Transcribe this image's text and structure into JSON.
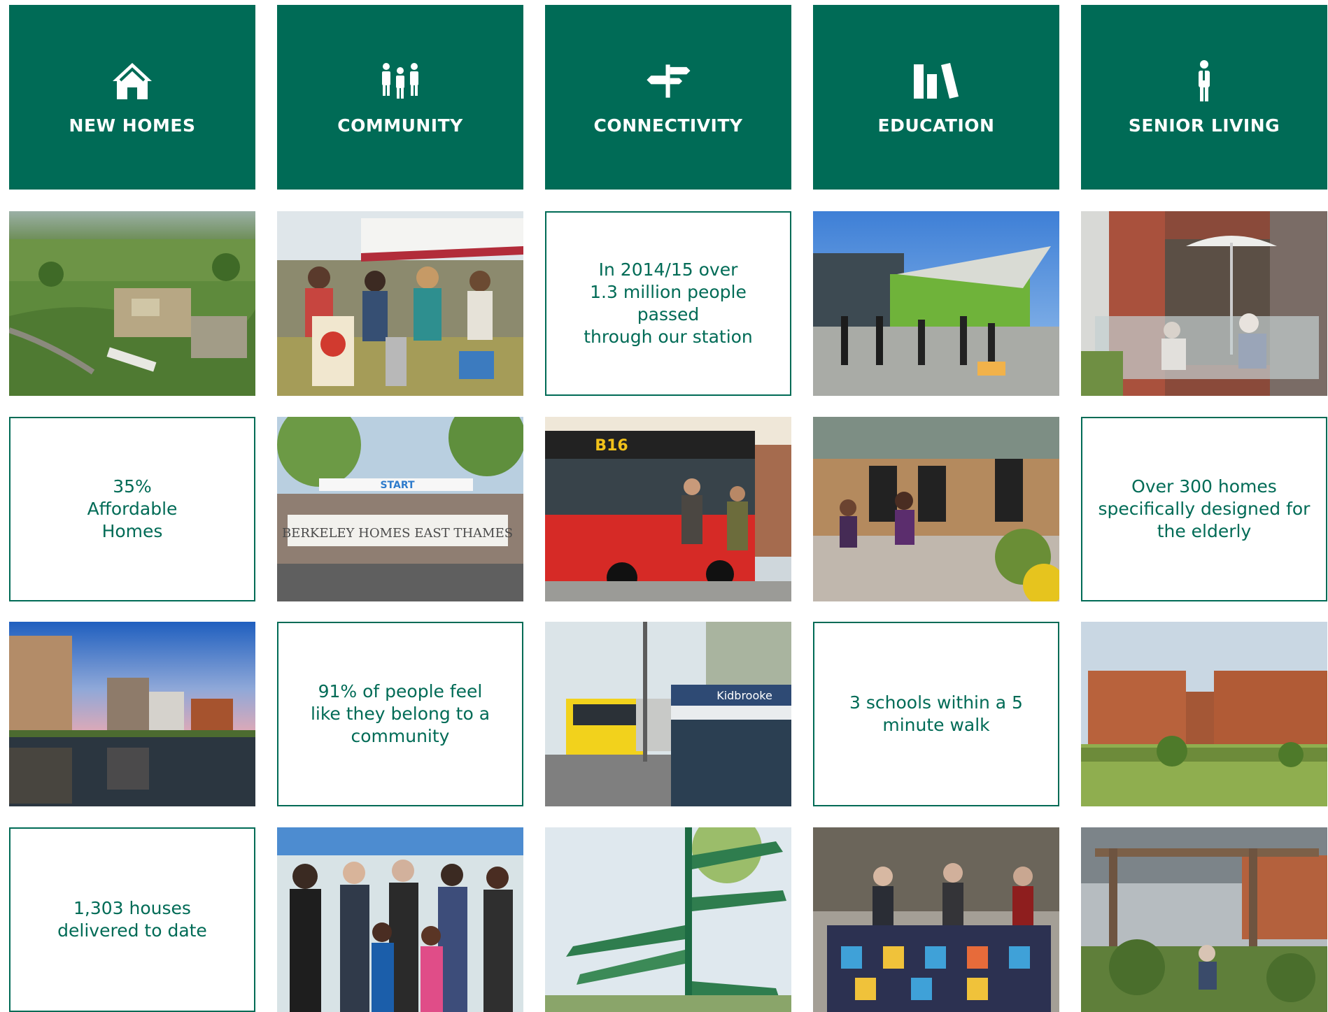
{
  "colors": {
    "brand_green": "#006b56",
    "white": "#ffffff"
  },
  "headers": [
    {
      "label": "NEW HOMES",
      "icon": "house-icon"
    },
    {
      "label": "COMMUNITY",
      "icon": "people-icon"
    },
    {
      "label": "CONNECTIVITY",
      "icon": "signpost-icon"
    },
    {
      "label": "EDUCATION",
      "icon": "books-icon"
    },
    {
      "label": "SENIOR LIVING",
      "icon": "person-icon"
    }
  ],
  "stats": {
    "connectivity_station": "In 2014/15 over\n1.3 million people passed\nthrough our station",
    "affordable_homes": "35%\nAffordable\nHomes",
    "senior_homes": "Over 300 homes\nspecifically designed for\nthe elderly",
    "community_belonging": "91% of people feel\nlike they belong to a\ncommunity",
    "schools_walk": "3 schools within a 5\nminute walk",
    "houses_delivered": "1,303 houses\ndelivered to date"
  },
  "photo_signs": {
    "race_banner_start": "START",
    "race_banner_text": "BERKELEY HOMES EAST THAMES",
    "bus_route": "B16",
    "station_sign": "Kidbrooke"
  }
}
